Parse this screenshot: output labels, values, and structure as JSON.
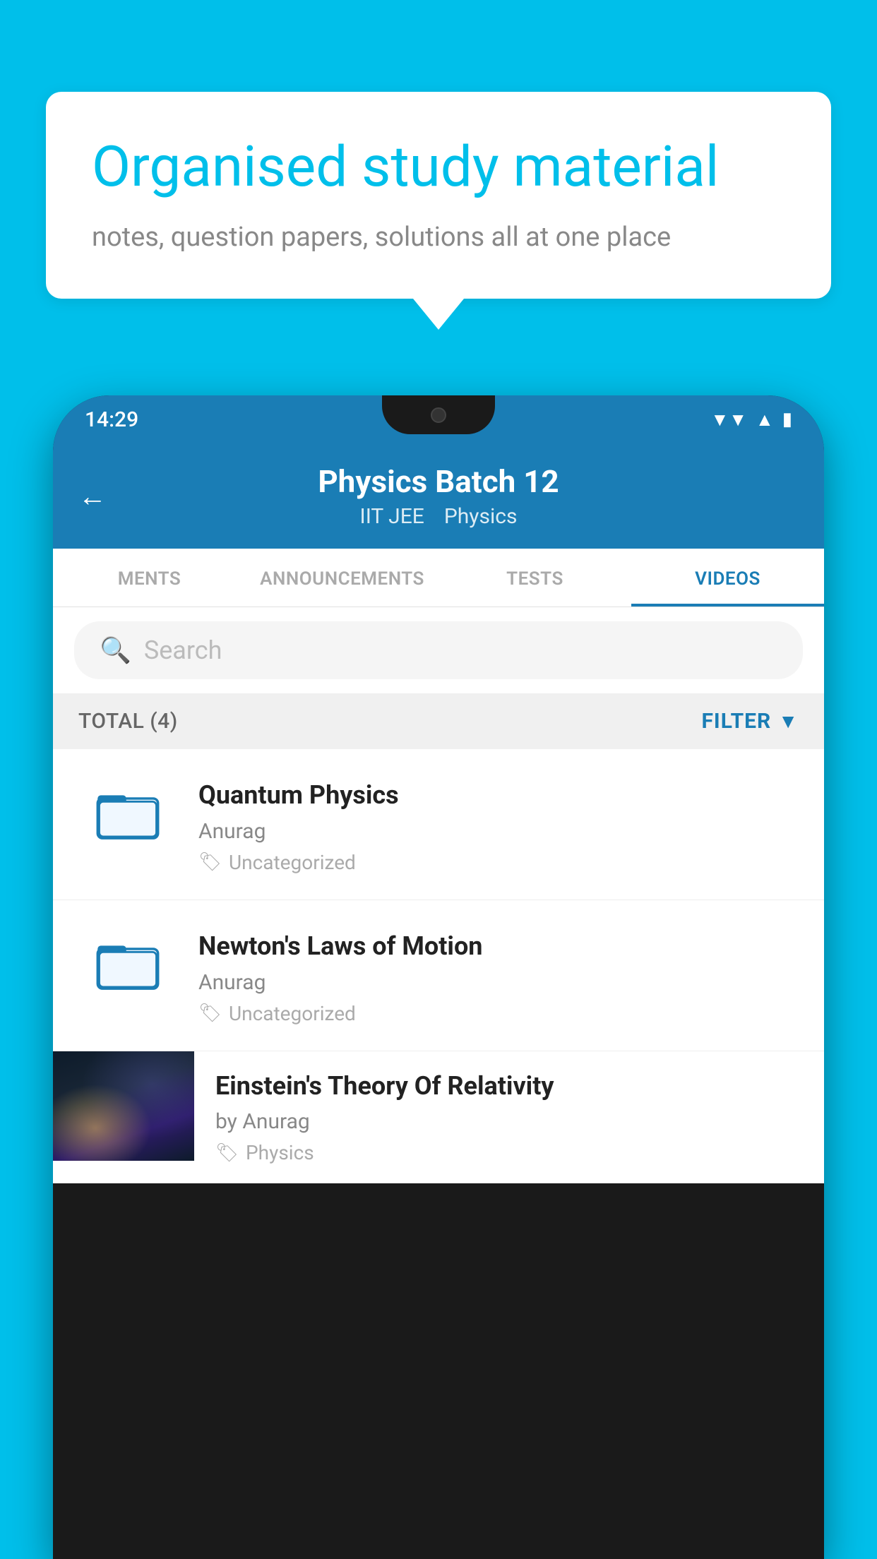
{
  "background_color": "#00BFEA",
  "speech_bubble": {
    "heading": "Organised study material",
    "subtext": "notes, question papers, solutions all at one place"
  },
  "status_bar": {
    "time": "14:29",
    "wifi_icon": "▼",
    "signal_icon": "◀",
    "battery_icon": "▮"
  },
  "app_header": {
    "back_label": "←",
    "title": "Physics Batch 12",
    "subtitle_parts": [
      "IIT JEE",
      "Physics"
    ]
  },
  "tabs": [
    {
      "label": "MENTS",
      "active": false
    },
    {
      "label": "ANNOUNCEMENTS",
      "active": false
    },
    {
      "label": "TESTS",
      "active": false
    },
    {
      "label": "VIDEOS",
      "active": true
    }
  ],
  "search": {
    "placeholder": "Search"
  },
  "filter_bar": {
    "total_label": "TOTAL (4)",
    "filter_label": "FILTER"
  },
  "videos": [
    {
      "id": "quantum",
      "title": "Quantum Physics",
      "author": "Anurag",
      "tag": "Uncategorized",
      "type": "folder",
      "has_thumbnail": false
    },
    {
      "id": "newton",
      "title": "Newton's Laws of Motion",
      "author": "Anurag",
      "tag": "Uncategorized",
      "type": "folder",
      "has_thumbnail": false
    },
    {
      "id": "einstein",
      "title": "Einstein's Theory Of Relativity",
      "author": "by Anurag",
      "tag": "Physics",
      "type": "video",
      "has_thumbnail": true
    }
  ]
}
